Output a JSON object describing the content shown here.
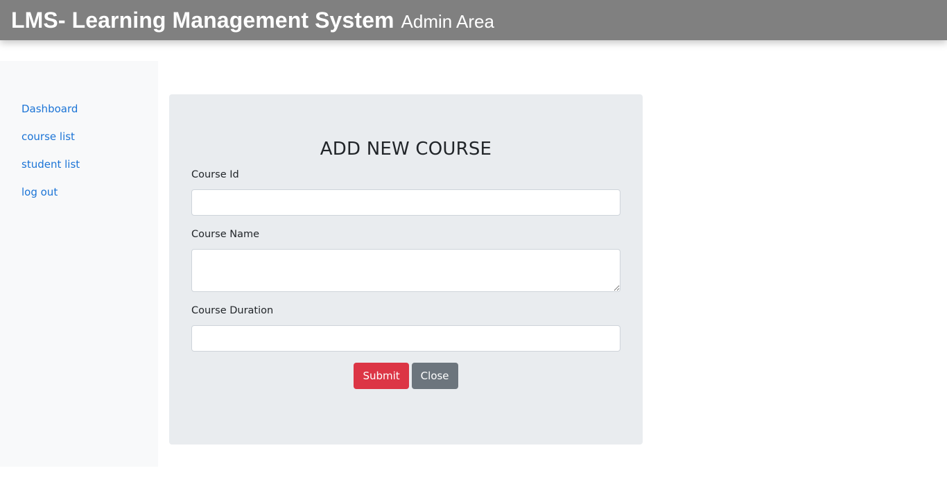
{
  "header": {
    "title": "LMS- Learning Management System",
    "subtitle": "Admin Area",
    "background": "#808080"
  },
  "sidebar": {
    "items": [
      {
        "label": "Dashboard"
      },
      {
        "label": "course list"
      },
      {
        "label": "student list"
      },
      {
        "label": "log out"
      }
    ]
  },
  "form": {
    "title": "ADD NEW COURSE",
    "fields": {
      "course_id": {
        "label": "Course Id",
        "value": ""
      },
      "course_name": {
        "label": "Course Name",
        "value": ""
      },
      "course_duration": {
        "label": "Course Duration",
        "value": ""
      }
    },
    "submit_label": "Submit",
    "close_label": "Close"
  },
  "colors": {
    "link": "#1b74d6",
    "submit": "#dc3545",
    "close": "#6c757d",
    "card": "#e9ecef",
    "sidebar": "#f8f9fa"
  }
}
